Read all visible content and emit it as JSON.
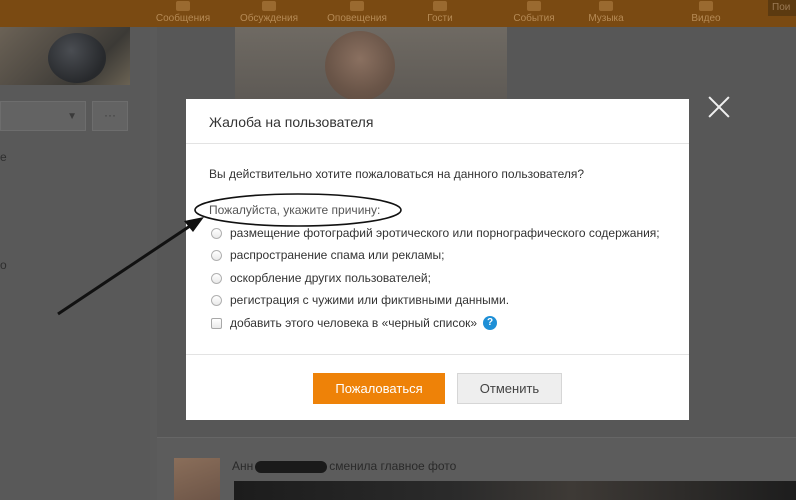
{
  "background": {
    "top_nav": [
      "Сообщения",
      "Обсуждения",
      "Оповещения",
      "Гости",
      "События",
      "Музыка",
      "Видео"
    ],
    "top_right": "Пои",
    "left_letters": [
      "e",
      "o"
    ],
    "feed": {
      "name_prefix": "Анн",
      "action": "сменила главное фото"
    }
  },
  "modal": {
    "title": "Жалоба на пользователя",
    "question": "Вы действительно хотите пожаловаться на данного пользователя?",
    "reason_label": "Пожалуйста, укажите причину:",
    "reasons": [
      "размещение фотографий эротического или порнографического содержания;",
      "распространение спама или рекламы;",
      "оскорбление других пользователей;",
      "регистрация с чужими или фиктивными данными."
    ],
    "blacklist_label": "добавить этого человека в «черный список»",
    "help_glyph": "?",
    "submit_label": "Пожаловаться",
    "cancel_label": "Отменить"
  },
  "colors": {
    "accent_orange": "#ee8208",
    "help_blue": "#1e8fd6",
    "overlay_dark": "#5a5a5a"
  },
  "icons": {
    "close": "close-icon",
    "help": "help-icon",
    "dropdown": "chevron-down-icon",
    "more": "more-icon"
  }
}
